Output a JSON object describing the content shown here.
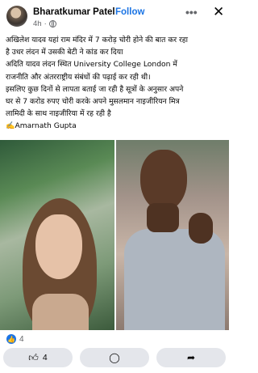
{
  "header": {
    "author": "Bharatkumar Patel",
    "separator": "·",
    "follow_label": "Follow",
    "time": "4h",
    "meta_separator": "·",
    "privacy_icon": "globe-icon",
    "more_icon": "more-options-icon",
    "close_icon": "close-icon"
  },
  "post": {
    "lines": [
      "अखिलेश यादव यहां राम मंदिर में 7 करोड़ चोरी होने की बात कर रहा",
      "है उधर लंदन में उसकी बेटी ने कांड कर दिया",
      " अदिति यादव लंदन स्थित University College London  में",
      "राजनीति और अंतरराष्ट्रीय संबंधों की पढ़ाई कर रही थी।",
      " इसलिए कुछ दिनों से लापता बताई जा रही है सूत्रों के अनुसार अपने",
      "घर से 7 करोड रुपए चोरी करके अपने मुसलमान नाइजीरियन मित्र",
      "लामिदी के साथ नाइजीरिया में रह रही है",
      "✍️Amarnath Gupta"
    ]
  },
  "reactions": {
    "icon": "like-badge-icon",
    "count": "4"
  },
  "actions": {
    "like_count": "4",
    "like_icon": "thumbs-up-icon",
    "comment_icon": "comment-icon",
    "share_icon": "share-icon"
  }
}
